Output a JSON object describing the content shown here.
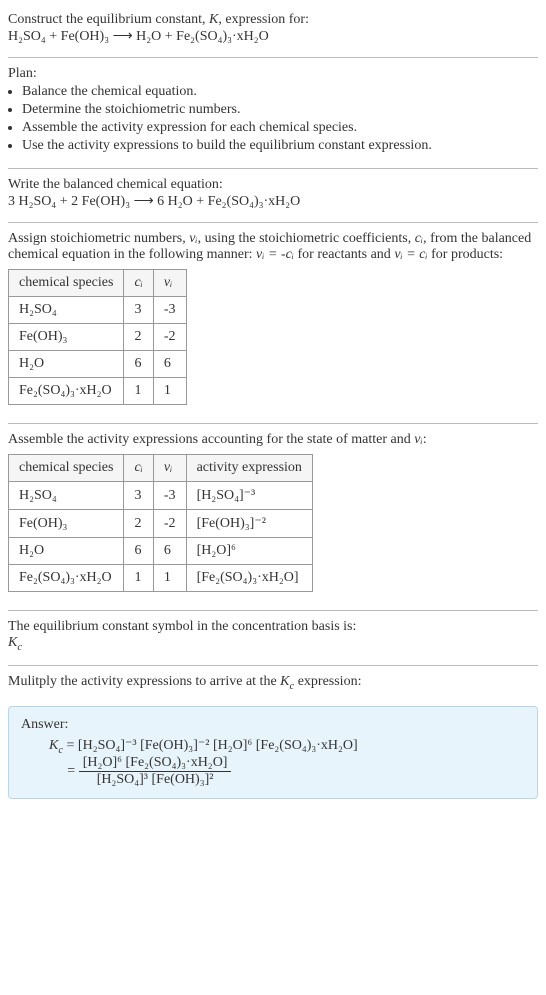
{
  "intro": {
    "line1": "Construct the equilibrium constant, ",
    "K": "K",
    "line1b": ", expression for:",
    "eq_unbalanced": "H₂SO₄ + Fe(OH)₃  ⟶  H₂O + Fe₂(SO₄)₃·xH₂O"
  },
  "plan": {
    "heading": "Plan:",
    "items": [
      "Balance the chemical equation.",
      "Determine the stoichiometric numbers.",
      "Assemble the activity expression for each chemical species.",
      "Use the activity expressions to build the equilibrium constant expression."
    ]
  },
  "balanced": {
    "heading": "Write the balanced chemical equation:",
    "eq": "3 H₂SO₄ + 2 Fe(OH)₃  ⟶  6 H₂O + Fe₂(SO₄)₃·xH₂O"
  },
  "stoich": {
    "text1": "Assign stoichiometric numbers, ",
    "nu": "νᵢ",
    "text2": ", using the stoichiometric coefficients, ",
    "ci": "cᵢ",
    "text3": ", from the balanced chemical equation in the following manner: ",
    "rel_react": "νᵢ = -cᵢ",
    "text4": " for reactants and ",
    "rel_prod": "νᵢ = cᵢ",
    "text5": " for products:"
  },
  "table1": {
    "headers": {
      "species": "chemical species",
      "ci": "cᵢ",
      "nu": "νᵢ"
    },
    "rows": [
      {
        "species": "H₂SO₄",
        "ci": "3",
        "nu": "-3"
      },
      {
        "species": "Fe(OH)₃",
        "ci": "2",
        "nu": "-2"
      },
      {
        "species": "H₂O",
        "ci": "6",
        "nu": "6"
      },
      {
        "species": "Fe₂(SO₄)₃·xH₂O",
        "ci": "1",
        "nu": "1"
      }
    ]
  },
  "assemble": {
    "text1": "Assemble the activity expressions accounting for the state of matter and ",
    "nu": "νᵢ",
    "text2": ":"
  },
  "table2": {
    "headers": {
      "species": "chemical species",
      "ci": "cᵢ",
      "nu": "νᵢ",
      "act": "activity expression"
    },
    "rows": [
      {
        "species": "H₂SO₄",
        "ci": "3",
        "nu": "-3",
        "act": "[H₂SO₄]⁻³"
      },
      {
        "species": "Fe(OH)₃",
        "ci": "2",
        "nu": "-2",
        "act": "[Fe(OH)₃]⁻²"
      },
      {
        "species": "H₂O",
        "ci": "6",
        "nu": "6",
        "act": "[H₂O]⁶"
      },
      {
        "species": "Fe₂(SO₄)₃·xH₂O",
        "ci": "1",
        "nu": "1",
        "act": "[Fe₂(SO₄)₃·xH₂O]"
      }
    ]
  },
  "kc_intro": {
    "text": "The equilibrium constant symbol in the concentration basis is:",
    "symbol": "K_c"
  },
  "multiply": {
    "text1": "Mulitply the activity expressions to arrive at the ",
    "kc": "K_c",
    "text2": " expression:"
  },
  "answer": {
    "heading": "Answer:",
    "kc": "K_c",
    "eq": " = ",
    "line1": "[H₂SO₄]⁻³ [Fe(OH)₃]⁻² [H₂O]⁶ [Fe₂(SO₄)₃·xH₂O]",
    "eq2": " = ",
    "num": "[H₂O]⁶ [Fe₂(SO₄)₃·xH₂O]",
    "den": "[H₂SO₄]³ [Fe(OH)₃]²"
  },
  "chart_data": {
    "type": "table",
    "tables": [
      {
        "title": "Stoichiometric coefficients and numbers",
        "columns": [
          "chemical species",
          "c_i",
          "ν_i"
        ],
        "rows": [
          [
            "H2SO4",
            3,
            -3
          ],
          [
            "Fe(OH)3",
            2,
            -2
          ],
          [
            "H2O",
            6,
            6
          ],
          [
            "Fe2(SO4)3·xH2O",
            1,
            1
          ]
        ]
      },
      {
        "title": "Activity expressions",
        "columns": [
          "chemical species",
          "c_i",
          "ν_i",
          "activity expression"
        ],
        "rows": [
          [
            "H2SO4",
            3,
            -3,
            "[H2SO4]^-3"
          ],
          [
            "Fe(OH)3",
            2,
            -2,
            "[Fe(OH)3]^-2"
          ],
          [
            "H2O",
            6,
            6,
            "[H2O]^6"
          ],
          [
            "Fe2(SO4)3·xH2O",
            1,
            1,
            "[Fe2(SO4)3·xH2O]"
          ]
        ]
      }
    ]
  }
}
